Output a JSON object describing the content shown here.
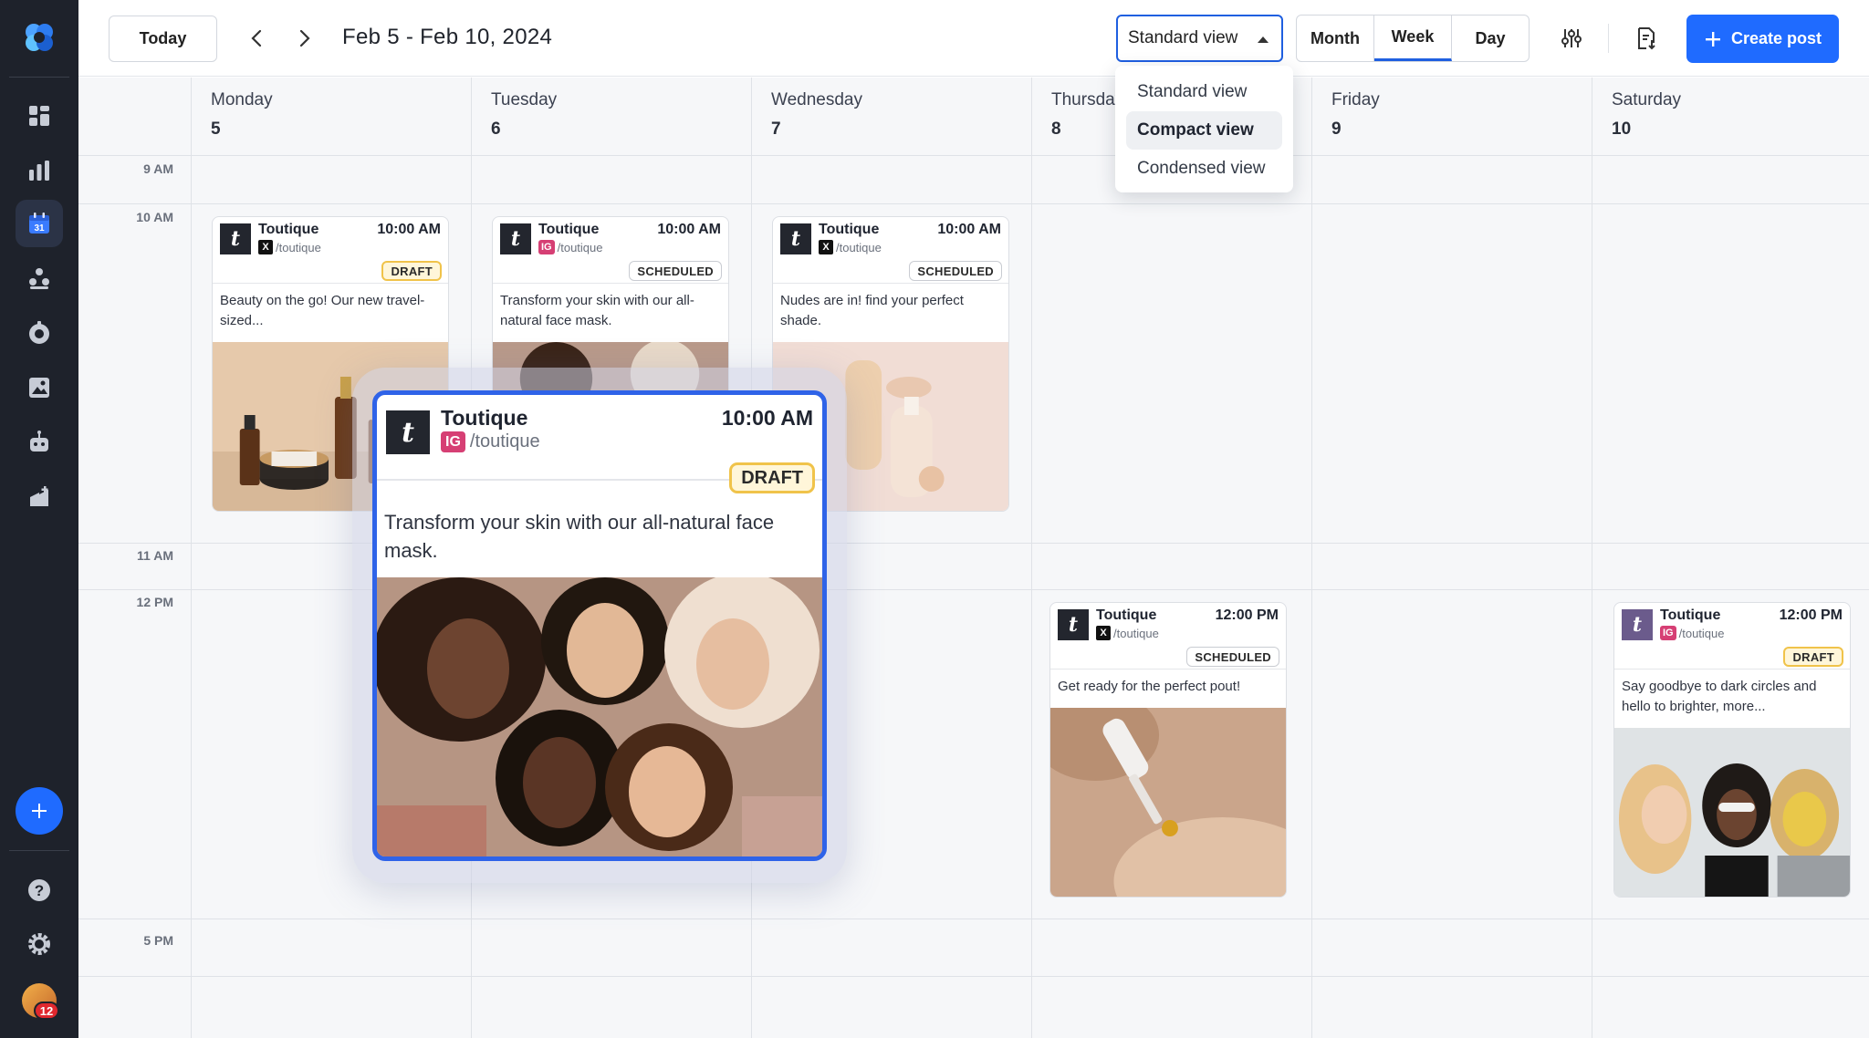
{
  "header": {
    "today_label": "Today",
    "date_range": "Feb 5 - Feb 10, 2024",
    "view_select_value": "Standard view",
    "view_modes": [
      "Month",
      "Week",
      "Day"
    ],
    "selected_mode": "Week",
    "create_label": "Create post"
  },
  "view_dropdown": {
    "options": [
      "Standard view",
      "Compact view",
      "Condensed view"
    ],
    "highlighted": "Compact view"
  },
  "days": [
    {
      "name": "Monday",
      "num": "5"
    },
    {
      "name": "Tuesday",
      "num": "6"
    },
    {
      "name": "Wednesday",
      "num": "7"
    },
    {
      "name": "Thursday",
      "num": "8"
    },
    {
      "name": "Friday",
      "num": "9"
    },
    {
      "name": "Saturday",
      "num": "10"
    }
  ],
  "time_labels": [
    "9 AM",
    "10 AM",
    "11 AM",
    "12 PM",
    "5 PM"
  ],
  "posts": [
    {
      "account": "Toutique",
      "handle": "/toutique",
      "network": "X",
      "time": "10:00 AM",
      "status": "DRAFT",
      "text": "Beauty on the go! Our new travel-sized..."
    },
    {
      "account": "Toutique",
      "handle": "/toutique",
      "network": "IG",
      "time": "10:00 AM",
      "status": "SCHEDULED",
      "text": "Transform your skin with our all-natural face mask."
    },
    {
      "account": "Toutique",
      "handle": "/toutique",
      "network": "X",
      "time": "10:00 AM",
      "status": "SCHEDULED",
      "text": "Nudes are in! find your perfect shade."
    },
    {
      "account": "Toutique",
      "handle": "/toutique",
      "network": "X",
      "time": "12:00 PM",
      "status": "SCHEDULED",
      "text": "Get ready for the perfect pout!"
    },
    {
      "account": "Toutique",
      "handle": "/toutique",
      "network": "IG",
      "time": "12:00 PM",
      "status": "DRAFT",
      "text": "Say goodbye to dark circles and hello to brighter, more..."
    }
  ],
  "dragged_post": {
    "account": "Toutique",
    "handle": "/toutique",
    "network": "IG",
    "time": "10:00 AM",
    "status": "DRAFT",
    "text": "Transform your skin with our all-natural face mask."
  },
  "sidebar": {
    "notification_count": "12",
    "icons": [
      "dashboard-icon",
      "analytics-icon",
      "calendar-icon",
      "audience-icon",
      "engagement-icon",
      "media-library-icon",
      "automation-bot-icon",
      "campaigns-icon",
      "help-icon",
      "settings-icon"
    ],
    "calendar_day": "31"
  },
  "colors": {
    "accent": "#1f6bff",
    "sidebar_bg": "#1e222b",
    "draft_border": "#f0c34a",
    "ig_badge": "#d63f74"
  }
}
